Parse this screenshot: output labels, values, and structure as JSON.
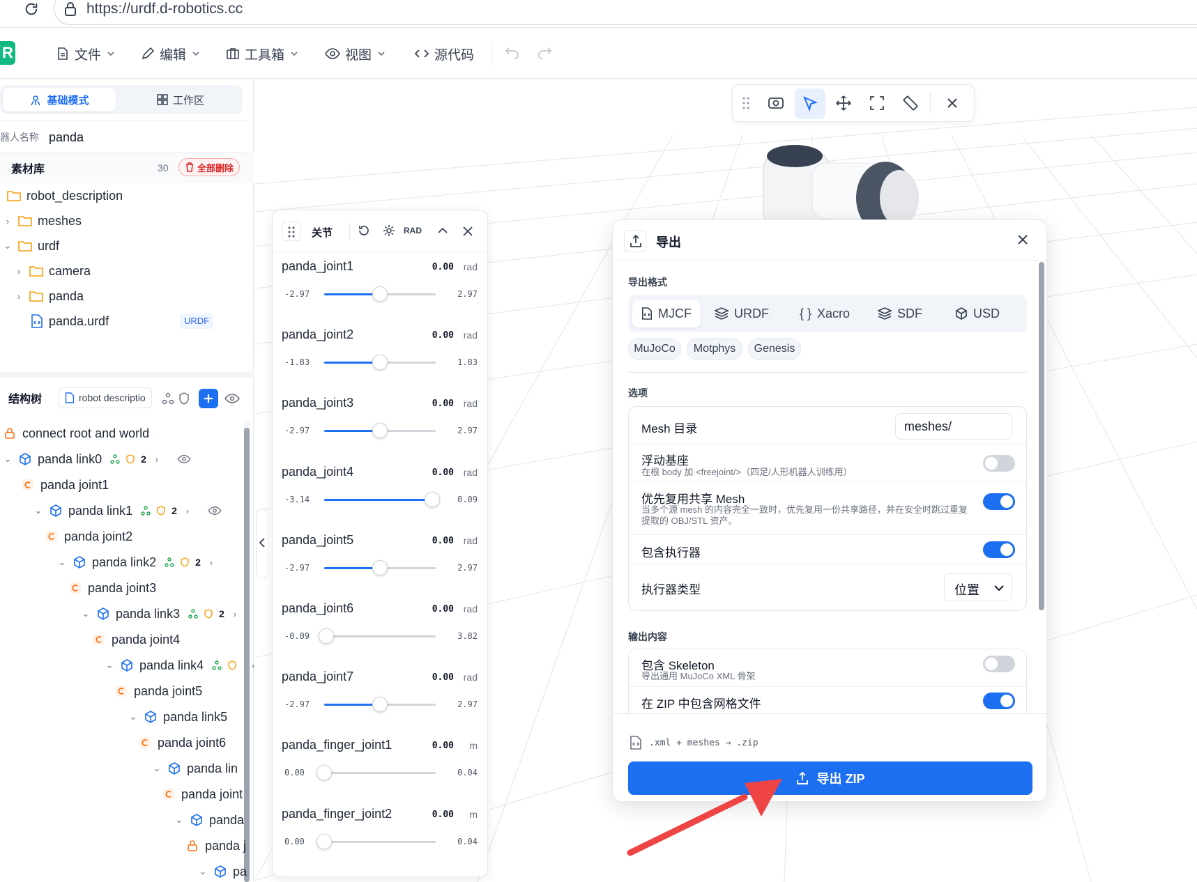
{
  "browser": {
    "url": "https://urdf.d-robotics.cc"
  },
  "menu": {
    "file": "文件",
    "edit": "编辑",
    "toolbox": "工具箱",
    "view": "视图",
    "source": "源代码"
  },
  "left": {
    "tabs": {
      "basic": "基础模式",
      "workspace": "工作区"
    },
    "robot_name_label": "器人名称",
    "robot_name_value": "panda",
    "library_title": "素材库",
    "library_count": "30",
    "delete_all": "全部删除",
    "files": [
      {
        "label": "robot_description",
        "badge": ""
      },
      {
        "label": "meshes",
        "badge": ""
      },
      {
        "label": "urdf",
        "badge": ""
      },
      {
        "label": "camera",
        "badge": ""
      },
      {
        "label": "panda",
        "badge": ""
      },
      {
        "label": "panda.urdf",
        "badge": "URDF"
      }
    ],
    "tree_title": "结构树",
    "tree_root_select": "robot descriptio",
    "tree": [
      {
        "label": "connect root and world",
        "count": ""
      },
      {
        "label": "panda link0",
        "count": "2"
      },
      {
        "label": "panda joint1",
        "count": ""
      },
      {
        "label": "panda link1",
        "count": "2"
      },
      {
        "label": "panda joint2",
        "count": ""
      },
      {
        "label": "panda link2",
        "count": "2"
      },
      {
        "label": "panda joint3",
        "count": ""
      },
      {
        "label": "panda link3",
        "count": "2"
      },
      {
        "label": "panda joint4",
        "count": ""
      },
      {
        "label": "panda link4",
        "count": ""
      },
      {
        "label": "panda joint5",
        "count": ""
      },
      {
        "label": "panda link5",
        "count": ""
      },
      {
        "label": "panda joint6",
        "count": ""
      },
      {
        "label": "panda lin",
        "count": ""
      },
      {
        "label": "panda joint",
        "count": ""
      },
      {
        "label": "panda",
        "count": ""
      },
      {
        "label": "panda j",
        "count": ""
      },
      {
        "label": "pa",
        "count": ""
      }
    ]
  },
  "joints": {
    "title": "关节",
    "unit_mode": "RAD",
    "items": [
      {
        "name": "panda_joint1",
        "value": "0.00",
        "unit": "rad",
        "min": "-2.97",
        "max": "2.97",
        "pos": 0.5
      },
      {
        "name": "panda_joint2",
        "value": "0.00",
        "unit": "rad",
        "min": "-1.83",
        "max": "1.83",
        "pos": 0.5
      },
      {
        "name": "panda_joint3",
        "value": "0.00",
        "unit": "rad",
        "min": "-2.97",
        "max": "2.97",
        "pos": 0.5
      },
      {
        "name": "panda_joint4",
        "value": "0.00",
        "unit": "rad",
        "min": "-3.14",
        "max": "0.09",
        "pos": 0.97
      },
      {
        "name": "panda_joint5",
        "value": "0.00",
        "unit": "rad",
        "min": "-2.97",
        "max": "2.97",
        "pos": 0.5
      },
      {
        "name": "panda_joint6",
        "value": "0.00",
        "unit": "rad",
        "min": "-0.09",
        "max": "3.82",
        "pos": 0.02
      },
      {
        "name": "panda_joint7",
        "value": "0.00",
        "unit": "rad",
        "min": "-2.97",
        "max": "2.97",
        "pos": 0.5
      },
      {
        "name": "panda_finger_joint1",
        "value": "0.00",
        "unit": "m",
        "min": "0.00",
        "max": "0.04",
        "pos": 0.0
      },
      {
        "name": "panda_finger_joint2",
        "value": "0.00",
        "unit": "m",
        "min": "0.00",
        "max": "0.04",
        "pos": 0.0
      }
    ]
  },
  "export": {
    "title": "导出",
    "format_heading": "导出格式",
    "formats": [
      "MJCF",
      "URDF",
      "Xacro",
      "SDF",
      "USD"
    ],
    "selected_format": "MJCF",
    "targets": [
      "MuJoCo",
      "Motphys",
      "Genesis"
    ],
    "options_heading": "选项",
    "mesh_dir_label": "Mesh 目录",
    "mesh_dir_value": "meshes/",
    "floating_base_label": "浮动基座",
    "floating_base_desc": "在根 body 加 <freejoint/>（四足/人形机器人训练用）",
    "floating_base_on": false,
    "reuse_mesh_label": "优先复用共享 Mesh",
    "reuse_mesh_desc": "当多个源 mesh 的内容完全一致时，优先复用一份共享路径，并在安全时跳过重复提取的 OBJ/STL 资产。",
    "reuse_mesh_on": true,
    "actuator_label": "包含执行器",
    "actuator_on": true,
    "actuator_type_label": "执行器类型",
    "actuator_type_value": "位置",
    "output_heading": "输出内容",
    "skeleton_label": "包含 Skeleton",
    "skeleton_desc": "导出通用 MuJoCo XML 骨架",
    "skeleton_on": false,
    "zip_mesh_label": "在 ZIP 中包含网格文件",
    "zip_mesh_on": true,
    "file_hint": ".xml + meshes → .zip",
    "export_button": "导出 ZIP"
  },
  "colors": {
    "accent": "#1d6ff2",
    "danger": "#dc2626",
    "arrow": "#ef4444"
  }
}
